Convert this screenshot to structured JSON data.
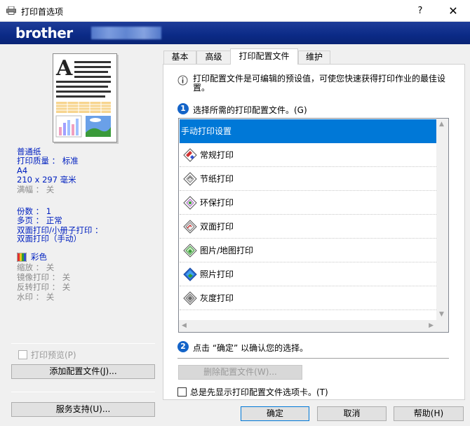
{
  "window": {
    "title": "打印首选项",
    "help_label": "?",
    "close_label": "✕"
  },
  "banner": {
    "logo": "brother"
  },
  "summary": {
    "paper_type": "普通纸",
    "print_quality": "打印质量 ： 标准",
    "paper_size": "A4",
    "paper_dims": "210 x 297 毫米",
    "full_page": "满幅 ： 关",
    "copies": "份数 ： 1",
    "multi_page": "多页 ： 正常",
    "duplex_line1": "双面打印/小册子打印 ：",
    "duplex_line2": "双面打印（手动）",
    "color_mode": "彩色",
    "scaling": "缩放 ： 关",
    "mirror": "镜像打印 ： 关",
    "reverse": "反转打印 ： 关",
    "watermark": "水印 ： 关"
  },
  "left_controls": {
    "print_preview": "打印预览(P)",
    "add_profile": "添加配置文件(J)...",
    "support": "服务支持(U)..."
  },
  "tabs": [
    {
      "label": "基本"
    },
    {
      "label": "高级"
    },
    {
      "label": "打印配置文件"
    },
    {
      "label": "维护"
    }
  ],
  "panel": {
    "info_text_line1": "打印配置文件是可编辑的预设值，可使您快速获得打印作业的最佳设",
    "info_text_line2": "置。",
    "step1_num": "1",
    "step1_label": "选择所需的打印配置文件。(G)",
    "step2_num": "2",
    "step2_label": "点击 “确定” 以确认您的选择。",
    "delete_profile": "删除配置文件(W)...",
    "always_show": "总是先显示打印配置文件选项卡。(T)"
  },
  "profiles": [
    {
      "label": "手动打印设置",
      "selected": true,
      "icon": "none"
    },
    {
      "label": "常规打印",
      "icon": "general-print-icon"
    },
    {
      "label": "节纸打印",
      "icon": "paper-save-icon"
    },
    {
      "label": "环保打印",
      "icon": "eco-print-icon"
    },
    {
      "label": "双面打印",
      "icon": "duplex-print-icon"
    },
    {
      "label": "图片/地图打印",
      "icon": "image-map-icon"
    },
    {
      "label": "照片打印",
      "icon": "photo-print-icon"
    },
    {
      "label": "灰度打印",
      "icon": "grayscale-print-icon"
    }
  ],
  "buttons": {
    "ok": "确定",
    "cancel": "取消",
    "help": "帮助(H)"
  },
  "colors": {
    "banner": "#0b2a86",
    "selection": "#0078d7",
    "summary_text": "#0020c0",
    "step_badge": "#1464c8"
  }
}
